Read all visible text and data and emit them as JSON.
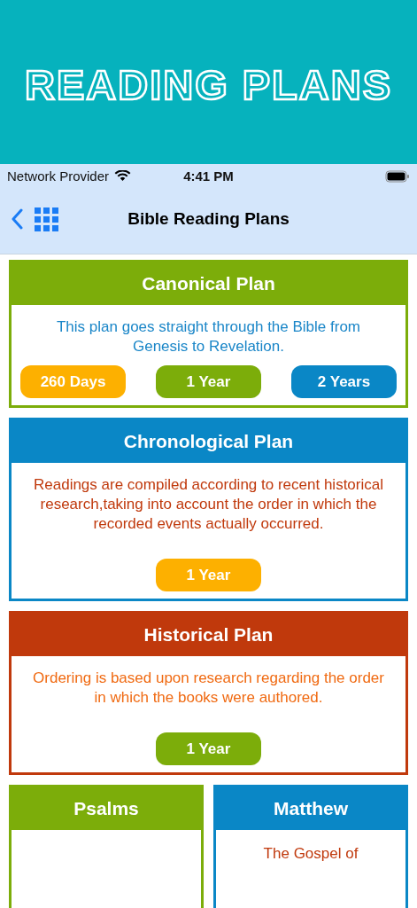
{
  "banner": {
    "title": "READING PLANS"
  },
  "status_bar": {
    "carrier": "Network Provider",
    "time": "4:41 PM"
  },
  "nav": {
    "title": "Bible Reading Plans"
  },
  "plans": [
    {
      "title": "Canonical Plan",
      "description": {
        "text": "This plan goes straight through the Bible from Genesis to Revelation.",
        "color": "#1a86c8"
      },
      "color": "#7cad0a",
      "buttons": [
        {
          "label": "260 Days",
          "color": "#fdb000"
        },
        {
          "label": "1 Year",
          "color": "#7cad0a"
        },
        {
          "label": "2 Years",
          "color": "#0a87c6"
        }
      ]
    },
    {
      "title": "Chronological Plan",
      "description": {
        "text": "Readings are compiled according to recent historical research,taking into account the order in which the recorded events actually occurred.",
        "color": "#c0390c"
      },
      "color": "#0a87c6",
      "buttons": [
        {
          "label": "1 Year",
          "color": "#fdb000"
        }
      ]
    },
    {
      "title": "Historical Plan",
      "description": {
        "text": "Ordering is based upon research regarding the order in which the books were authored.",
        "color": "#f06a12"
      },
      "color": "#c0390c",
      "buttons": [
        {
          "label": "1 Year",
          "color": "#7cad0a"
        }
      ]
    }
  ],
  "small_plans": [
    {
      "title": "Psalms",
      "color": "#7cad0a"
    },
    {
      "title": "Matthew",
      "color": "#0a87c6",
      "description": {
        "text": "The Gospel of",
        "color": "#c0390c"
      }
    }
  ]
}
